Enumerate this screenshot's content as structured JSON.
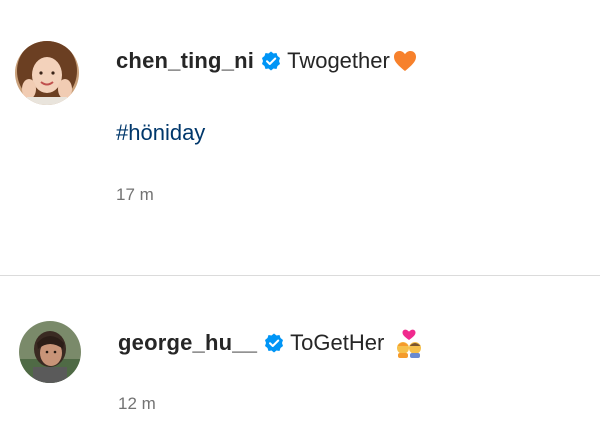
{
  "comments": [
    {
      "username": "chen_ting_ni",
      "text": "Twogether",
      "hashtag": "#höniday",
      "time": "17 m",
      "avatar_icon": "avatar-photo",
      "emoji_icon": "orange-heart-icon",
      "emoji_color": "#f7812c"
    },
    {
      "username": "george_hu__",
      "text": "ToGetHer",
      "time": "12 m",
      "avatar_icon": "avatar-photo",
      "emoji_icon": "couple-with-heart-icon",
      "emoji_color": "#f02a8e"
    }
  ],
  "colors": {
    "verified": "#0095f6",
    "hashtag": "#00376b",
    "timestamp": "#737373",
    "divider": "#dbdbdb"
  }
}
